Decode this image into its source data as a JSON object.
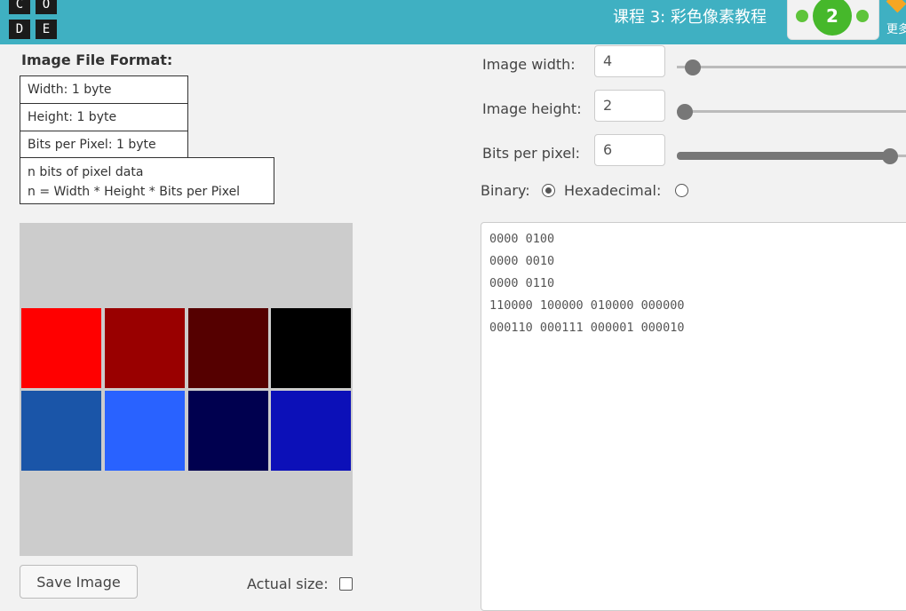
{
  "header": {
    "logo_letters": [
      "C",
      "O",
      "D",
      "E"
    ],
    "title": "课程 3: 彩色像素教程",
    "progress_level": "2",
    "more_label": "更多",
    "colors": {
      "bar": "#3fb0c2",
      "level_bubble": "#46b82b"
    }
  },
  "format": {
    "heading": "Image File Format:",
    "rows": [
      "Width: 1 byte",
      "Height: 1 byte",
      "Bits per Pixel: 1 byte"
    ],
    "pixel_data_line1": "n bits of pixel data",
    "pixel_data_line2": "n = Width * Height * Bits per Pixel"
  },
  "canvas": {
    "background": "#cccccc",
    "pixels": [
      [
        "#ff0000",
        "#990000",
        "#550000",
        "#000000"
      ],
      [
        "#1a55a8",
        "#2962ff",
        "#00004f",
        "#0c10b8"
      ]
    ]
  },
  "save_button": "Save Image",
  "actual_size": {
    "label": "Actual size:",
    "checked": false
  },
  "controls": {
    "width": {
      "label": "Image width:",
      "value": "4",
      "slider_fraction": 0.05
    },
    "height": {
      "label": "Image height:",
      "value": "2",
      "slider_fraction": 0.03
    },
    "bpp": {
      "label": "Bits per pixel:",
      "value": "6",
      "slider_fraction": 0.95
    }
  },
  "encoding": {
    "binary_label": "Binary:",
    "hex_label": "Hexadecimal:",
    "selected": "binary"
  },
  "binary_lines": [
    "0000 0100",
    "0000 0010",
    "0000 0110",
    "110000 100000 010000 000000",
    "000110 000111 000001 000010"
  ]
}
